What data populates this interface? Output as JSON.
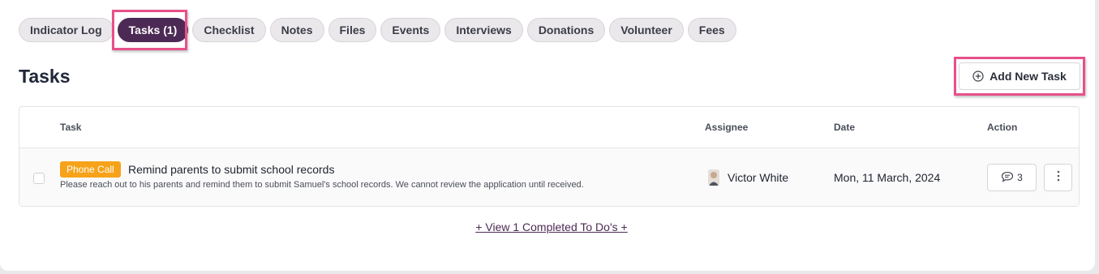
{
  "tabs": [
    {
      "label": "Indicator Log",
      "active": false
    },
    {
      "label": "Tasks (1)",
      "active": true
    },
    {
      "label": "Checklist",
      "active": false
    },
    {
      "label": "Notes",
      "active": false
    },
    {
      "label": "Files",
      "active": false
    },
    {
      "label": "Events",
      "active": false
    },
    {
      "label": "Interviews",
      "active": false
    },
    {
      "label": "Donations",
      "active": false
    },
    {
      "label": "Volunteer",
      "active": false
    },
    {
      "label": "Fees",
      "active": false
    }
  ],
  "header": {
    "title": "Tasks",
    "add_button_label": "Add New Task",
    "add_button_icon": "plus-circle-icon"
  },
  "table": {
    "columns": {
      "task": "Task",
      "assignee": "Assignee",
      "date": "Date",
      "action": "Action"
    },
    "rows": [
      {
        "badge": "Phone Call",
        "title": "Remind parents to submit school records",
        "description": "Please reach out to his parents and remind them to submit Samuel's school records. We cannot review the application until received.",
        "assignee": "Victor White",
        "date": "Mon, 11 March, 2024",
        "comment_count": "3"
      }
    ]
  },
  "footer": {
    "view_completed_label": "+ View 1 Completed To Do's +"
  },
  "colors": {
    "accent": "#4d2a55",
    "highlight": "#e8508a",
    "badge": "#f6a319"
  }
}
